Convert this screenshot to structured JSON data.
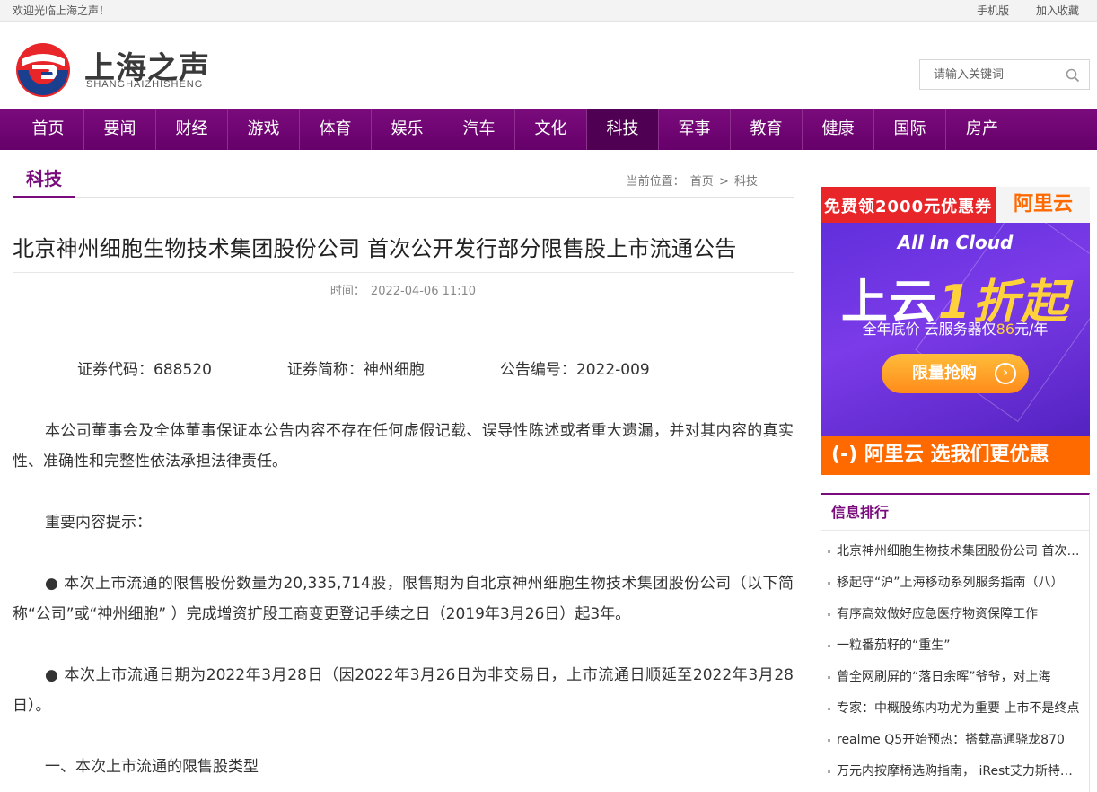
{
  "topbar": {
    "welcome": "欢迎光临上海之声！",
    "mobile": "手机版",
    "favorite": "加入收藏"
  },
  "logo": {
    "cn": "上海之声",
    "en": "SHANGHAIZHISHENG"
  },
  "search": {
    "placeholder": "请输入关键词",
    "icon": "search-icon"
  },
  "nav": {
    "items": [
      "首页",
      "要闻",
      "财经",
      "游戏",
      "体育",
      "娱乐",
      "汽车",
      "文化",
      "科技",
      "军事",
      "教育",
      "健康",
      "国际",
      "房产"
    ],
    "active": "科技"
  },
  "category": "科技",
  "breadcrumb": {
    "prefix": "当前位置：",
    "home": "首页",
    "sep": ">",
    "current": "科技"
  },
  "article": {
    "title": "北京神州细胞生物技术集团股份公司 首次公开发行部分限售股上市流通公告",
    "time_label": "时间：",
    "time": "2022-04-06 11:10",
    "code": "证券代码：688520",
    "abbr": "证券简称：神州细胞",
    "notice_no": "公告编号：2022-009",
    "p1": "本公司董事会及全体董事保证本公告内容不存在任何虚假记载、误导性陈述或者重大遗漏，并对其内容的真实性、准确性和完整性依法承担法律责任。",
    "p2": "重要内容提示：",
    "p3": "● 本次上市流通的限售股份数量为20,335,714股，限售期为自北京神州细胞生物技术集团股份公司（以下简称“公司”或“神州细胞” ）完成增资扩股工商变更登记手续之日（2019年3月26日）起3年。",
    "p4": "● 本次上市流通日期为2022年3月28日（因2022年3月26日为非交易日，上市流通日顺延至2022年3月28日）。",
    "p5": "一、本次上市流通的限售股类型"
  },
  "ad": {
    "strip_left": "免费领2000元优惠券",
    "strip_right": "阿里云",
    "cloud": "All In Cloud",
    "big_a": "上云",
    "big_b": "1折起",
    "sub_a": "全年底价  云服务器仅",
    "sub_price": "86",
    "sub_b": "元/年",
    "button": "限量抢购",
    "footer": "(-) 阿里云 选我们更优惠"
  },
  "ranking": {
    "title": "信息排行",
    "items": [
      "北京神州细胞生物技术集团股份公司 首次公开发行部分限售股上市流通公告",
      "移起守“沪”上海移动系列服务指南（八）",
      "有序高效做好应急医疗物资保障工作",
      "一粒番茄籽的“重生”",
      "曾全网刷屏的“落日余晖”爷爷，对上海",
      "专家：中概股练内功尤为重要 上市不是终点",
      "realme Q5开始预热：搭载高通骁龙870",
      "万元内按摩椅选购指南， iRest艾力斯特按摩椅"
    ]
  }
}
